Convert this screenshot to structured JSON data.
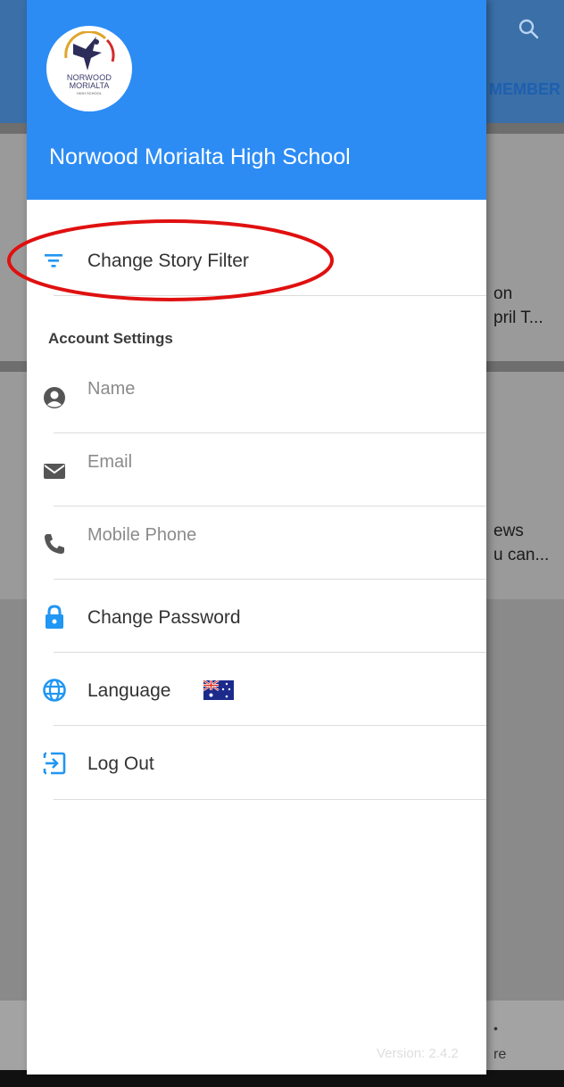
{
  "background": {
    "tab_label": "MEMBER",
    "card1_line1": "on",
    "card1_line2": "pril T...",
    "card2_line1": "ews",
    "card2_line2": "u can...",
    "bottom_text1": "•",
    "bottom_text2": "re"
  },
  "drawer": {
    "logo": {
      "text_line1": "NORWOOD",
      "text_line2": "MORIALTA",
      "text_line3": "HIGH SCHOOL"
    },
    "title": "Norwood Morialta High School",
    "change_story_filter": "Change Story Filter",
    "account_settings_title": "Account Settings",
    "name_placeholder": "Name",
    "email_placeholder": "Email",
    "mobile_placeholder": "Mobile Phone",
    "change_password": "Change Password",
    "language": "Language",
    "log_out": "Log Out",
    "version": "Version: 2.4.2"
  },
  "colors": {
    "header_blue": "#2c8cf4",
    "icon_blue": "#2196f3",
    "icon_gray": "#555555",
    "highlight_red": "#e01010"
  },
  "icons": {
    "filter": "filter-icon",
    "account": "account-circle-icon",
    "email": "envelope-icon",
    "phone": "phone-icon",
    "lock": "lock-icon",
    "globe": "globe-icon",
    "logout": "logout-icon",
    "search": "search-icon",
    "flag": "australia-flag-icon"
  }
}
